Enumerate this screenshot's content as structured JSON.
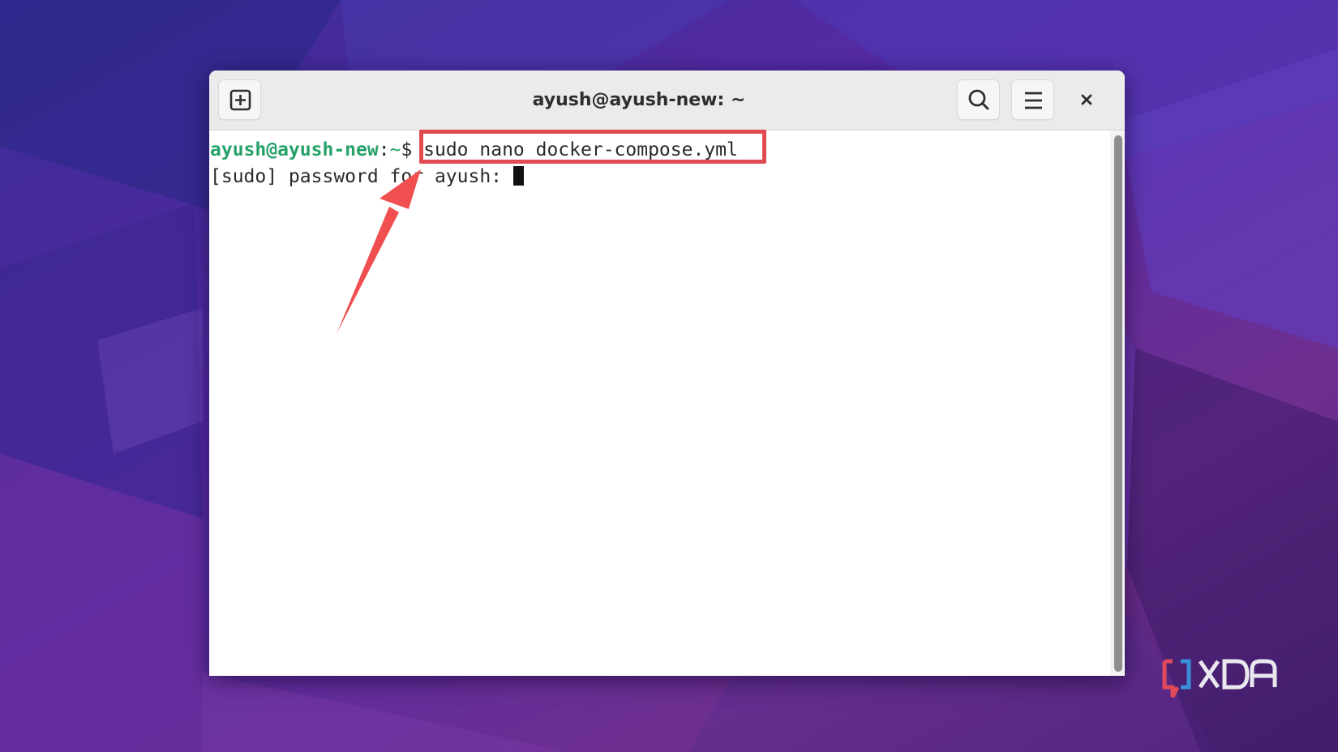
{
  "window": {
    "title": "ayush@ayush-new: ~"
  },
  "terminal": {
    "prompt_user_host": "ayush@ayush-new",
    "prompt_separator": ":",
    "prompt_path": "~",
    "prompt_symbol": "$",
    "command": " sudo nano docker-compose.yml",
    "output_line": "[sudo] password for ayush: "
  },
  "icons": {
    "new_tab": "new-tab-icon",
    "search": "search-icon",
    "menu": "hamburger-menu-icon",
    "close": "close-icon"
  },
  "annotations": {
    "highlight_color": "#e24a52",
    "arrow_color": "#ef4f4f"
  },
  "watermark": {
    "brand": "XDA"
  },
  "colors": {
    "prompt_green": "#26a269",
    "headerbar": "#ebebeb",
    "terminal_bg": "#ffffff"
  }
}
